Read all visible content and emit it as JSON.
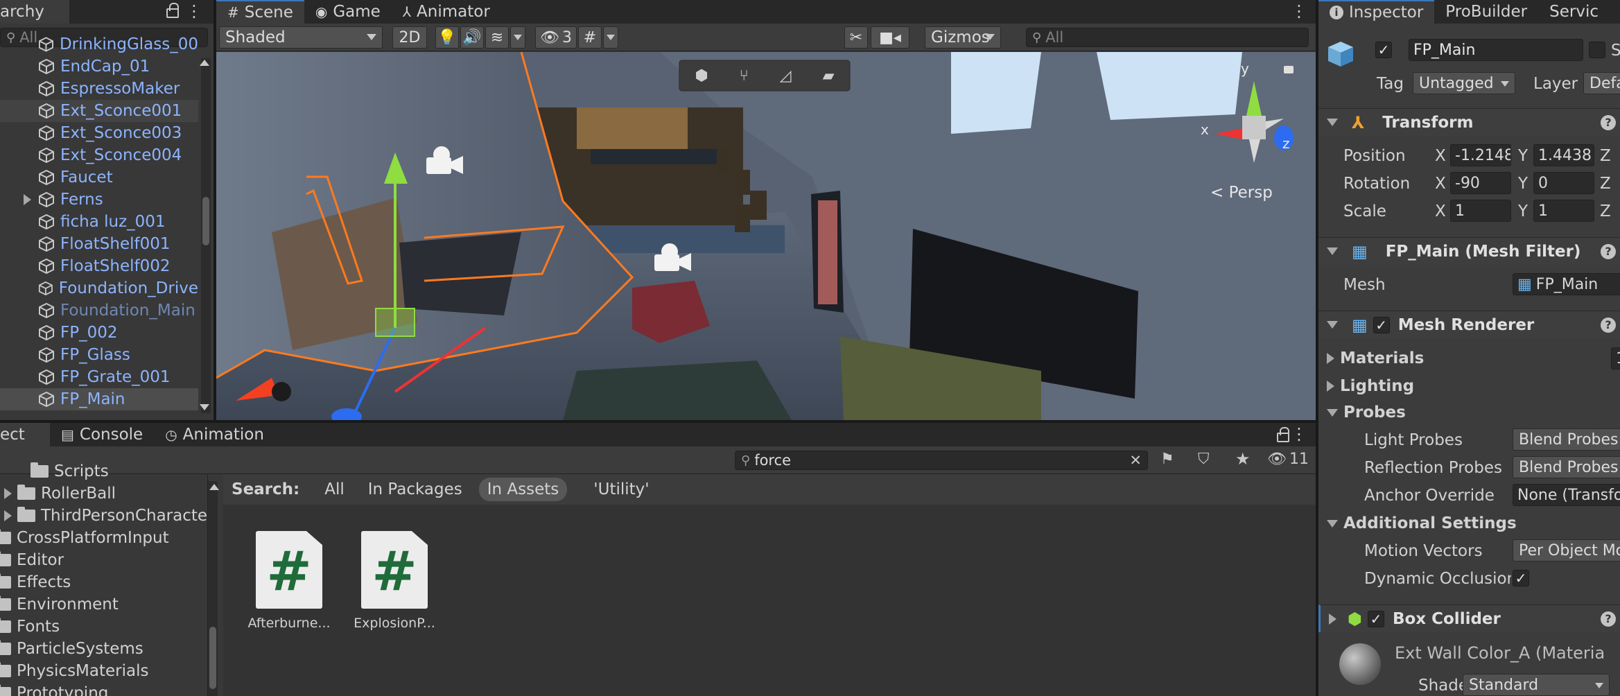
{
  "hierarchy": {
    "title": "archy",
    "search_placeholder": "All",
    "items": [
      {
        "label": "DrinkingGlass_00"
      },
      {
        "label": "EndCap_01"
      },
      {
        "label": "EspressoMaker"
      },
      {
        "label": "Ext_Sconce001"
      },
      {
        "label": "Ext_Sconce003"
      },
      {
        "label": "Ext_Sconce004"
      },
      {
        "label": "Faucet"
      },
      {
        "label": "Ferns"
      },
      {
        "label": "ficha luz_001"
      },
      {
        "label": "FloatShelf001"
      },
      {
        "label": "FloatShelf002"
      },
      {
        "label": "Foundation_Drive"
      },
      {
        "label": "Foundation_Main"
      },
      {
        "label": "FP_002"
      },
      {
        "label": "FP_Glass"
      },
      {
        "label": "FP_Grate_001"
      },
      {
        "label": "FP_Main"
      }
    ]
  },
  "scene": {
    "tabs": {
      "scene": "Scene",
      "game": "Game",
      "animator": "Animator"
    },
    "toolbar": {
      "draw_mode": "Shaded",
      "mode_2d": "2D",
      "hidden_count": "3",
      "gizmos": "Gizmos",
      "search_placeholder": "All"
    },
    "persp_label": "< Persp",
    "axis_x": "x",
    "axis_y": "y",
    "axis_z": "z"
  },
  "project": {
    "tabs": {
      "project": "ect",
      "console": "Console",
      "animation": "Animation"
    },
    "search_value": "force",
    "hidden_count": "11",
    "search_bar": {
      "label": "Search:",
      "all": "All",
      "in_packages": "In Packages",
      "in_assets": "In Assets",
      "utility": "'Utility'"
    },
    "tree": [
      {
        "label": "Scripts"
      },
      {
        "label": "RollerBall"
      },
      {
        "label": "ThirdPersonCharacte"
      },
      {
        "label": "CrossPlatformInput"
      },
      {
        "label": "Editor"
      },
      {
        "label": "Effects"
      },
      {
        "label": "Environment"
      },
      {
        "label": "Fonts"
      },
      {
        "label": "ParticleSystems"
      },
      {
        "label": "PhysicsMaterials"
      },
      {
        "label": "Prototyping"
      }
    ],
    "assets": [
      {
        "glyph": "#",
        "name": "Afterburne..."
      },
      {
        "glyph": "#",
        "name": "ExplosionP..."
      }
    ]
  },
  "inspector": {
    "tabs": {
      "inspector": "Inspector",
      "probuilder": "ProBuilder",
      "services": "Servic"
    },
    "object_name": "FP_Main",
    "static_label": "S",
    "tag_label": "Tag",
    "tag_value": "Untagged",
    "layer_label": "Layer",
    "layer_value": "Defa",
    "transform": {
      "title": "Transform",
      "position_label": "Position",
      "rotation_label": "Rotation",
      "scale_label": "Scale",
      "position": {
        "x": "-1.2148",
        "y": "1.4438"
      },
      "rotation": {
        "x": "-90",
        "y": "0"
      },
      "scale": {
        "x": "1",
        "y": "1"
      },
      "x": "X",
      "y": "Y",
      "z": "Z"
    },
    "mesh_filter": {
      "title": "FP_Main (Mesh Filter)",
      "mesh_label": "Mesh",
      "mesh_value": "FP_Main"
    },
    "mesh_renderer": {
      "title": "Mesh Renderer",
      "materials": "Materials",
      "materials_count": "1",
      "lighting": "Lighting",
      "probes": "Probes",
      "light_probes_label": "Light Probes",
      "light_probes_value": "Blend Probes",
      "reflection_probes_label": "Reflection Probes",
      "reflection_probes_value": "Blend Probes",
      "anchor_override_label": "Anchor Override",
      "anchor_override_value": "None (Transfo",
      "additional_settings": "Additional Settings",
      "motion_vectors_label": "Motion Vectors",
      "motion_vectors_value": "Per Object Mo",
      "dynamic_occlusion_label": "Dynamic Occlusion"
    },
    "box_collider": {
      "title": "Box Collider"
    },
    "material": {
      "name": "Ext Wall Color_A (Materia",
      "shader_label": "Shader",
      "shader_value": "Standard"
    }
  },
  "colors": {
    "selection_blue": "#3a79bb",
    "hierarchy_text": "#8cb4ff",
    "orange_outline": "#ff7a1f"
  }
}
